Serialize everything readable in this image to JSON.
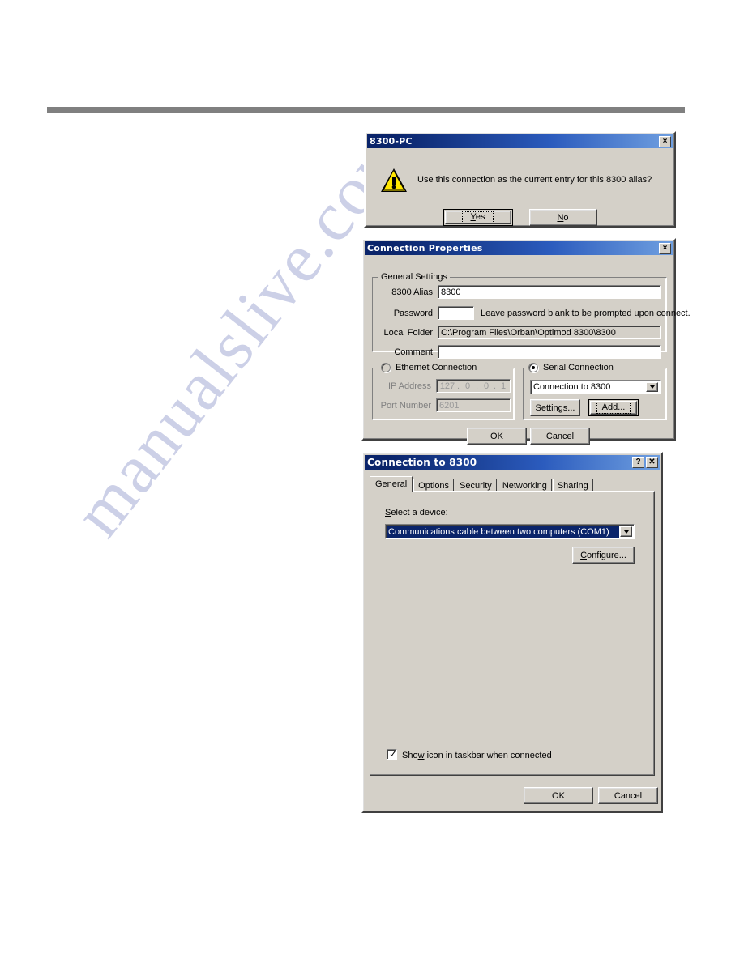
{
  "page": {
    "rule_color": "#808080",
    "watermark_text": "manualslive.com"
  },
  "message_dialog": {
    "title": "8300-PC",
    "close_label": "×",
    "icon": "warning-triangle-icon",
    "message": "Use this connection as the current entry for this 8300 alias?",
    "buttons": {
      "yes": "Yes",
      "no": "No"
    }
  },
  "properties_dialog": {
    "title": "Connection Properties",
    "close_label": "×",
    "general_group": {
      "legend": "General Settings",
      "alias_label": "8300 Alias",
      "alias_value": "8300",
      "password_label": "Password",
      "password_value": "",
      "password_note": "Leave password blank to be prompted upon connect.",
      "local_folder_label": "Local Folder",
      "local_folder_value": "C:\\Program Files\\Orban\\Optimod 8300\\8300",
      "comment_label": "Comment",
      "comment_value": ""
    },
    "ethernet_group": {
      "legend": "Ethernet Connection",
      "selected": false,
      "ip_label": "IP Address",
      "ip_octets": [
        "127",
        "0",
        "0",
        "1"
      ],
      "port_label": "Port Number",
      "port_value": "6201"
    },
    "serial_group": {
      "legend": "Serial Connection",
      "selected": true,
      "connection_value": "Connection to 8300",
      "settings_button": "Settings...",
      "add_button": "Add..."
    },
    "buttons": {
      "ok": "OK",
      "cancel": "Cancel"
    }
  },
  "connection_dialog": {
    "title": "Connection to 8300",
    "help_label": "?",
    "close_label": "✕",
    "tabs": [
      {
        "label": "General",
        "active": true
      },
      {
        "label": "Options",
        "active": false
      },
      {
        "label": "Security",
        "active": false
      },
      {
        "label": "Networking",
        "active": false
      },
      {
        "label": "Sharing",
        "active": false
      }
    ],
    "select_device_label": "Select a device:",
    "device_value": "Communications cable between two computers (COM1)",
    "configure_button": "Configure...",
    "show_icon_checkbox": {
      "label": "Show icon in taskbar when connected",
      "checked": true
    },
    "buttons": {
      "ok": "OK",
      "cancel": "Cancel"
    }
  }
}
